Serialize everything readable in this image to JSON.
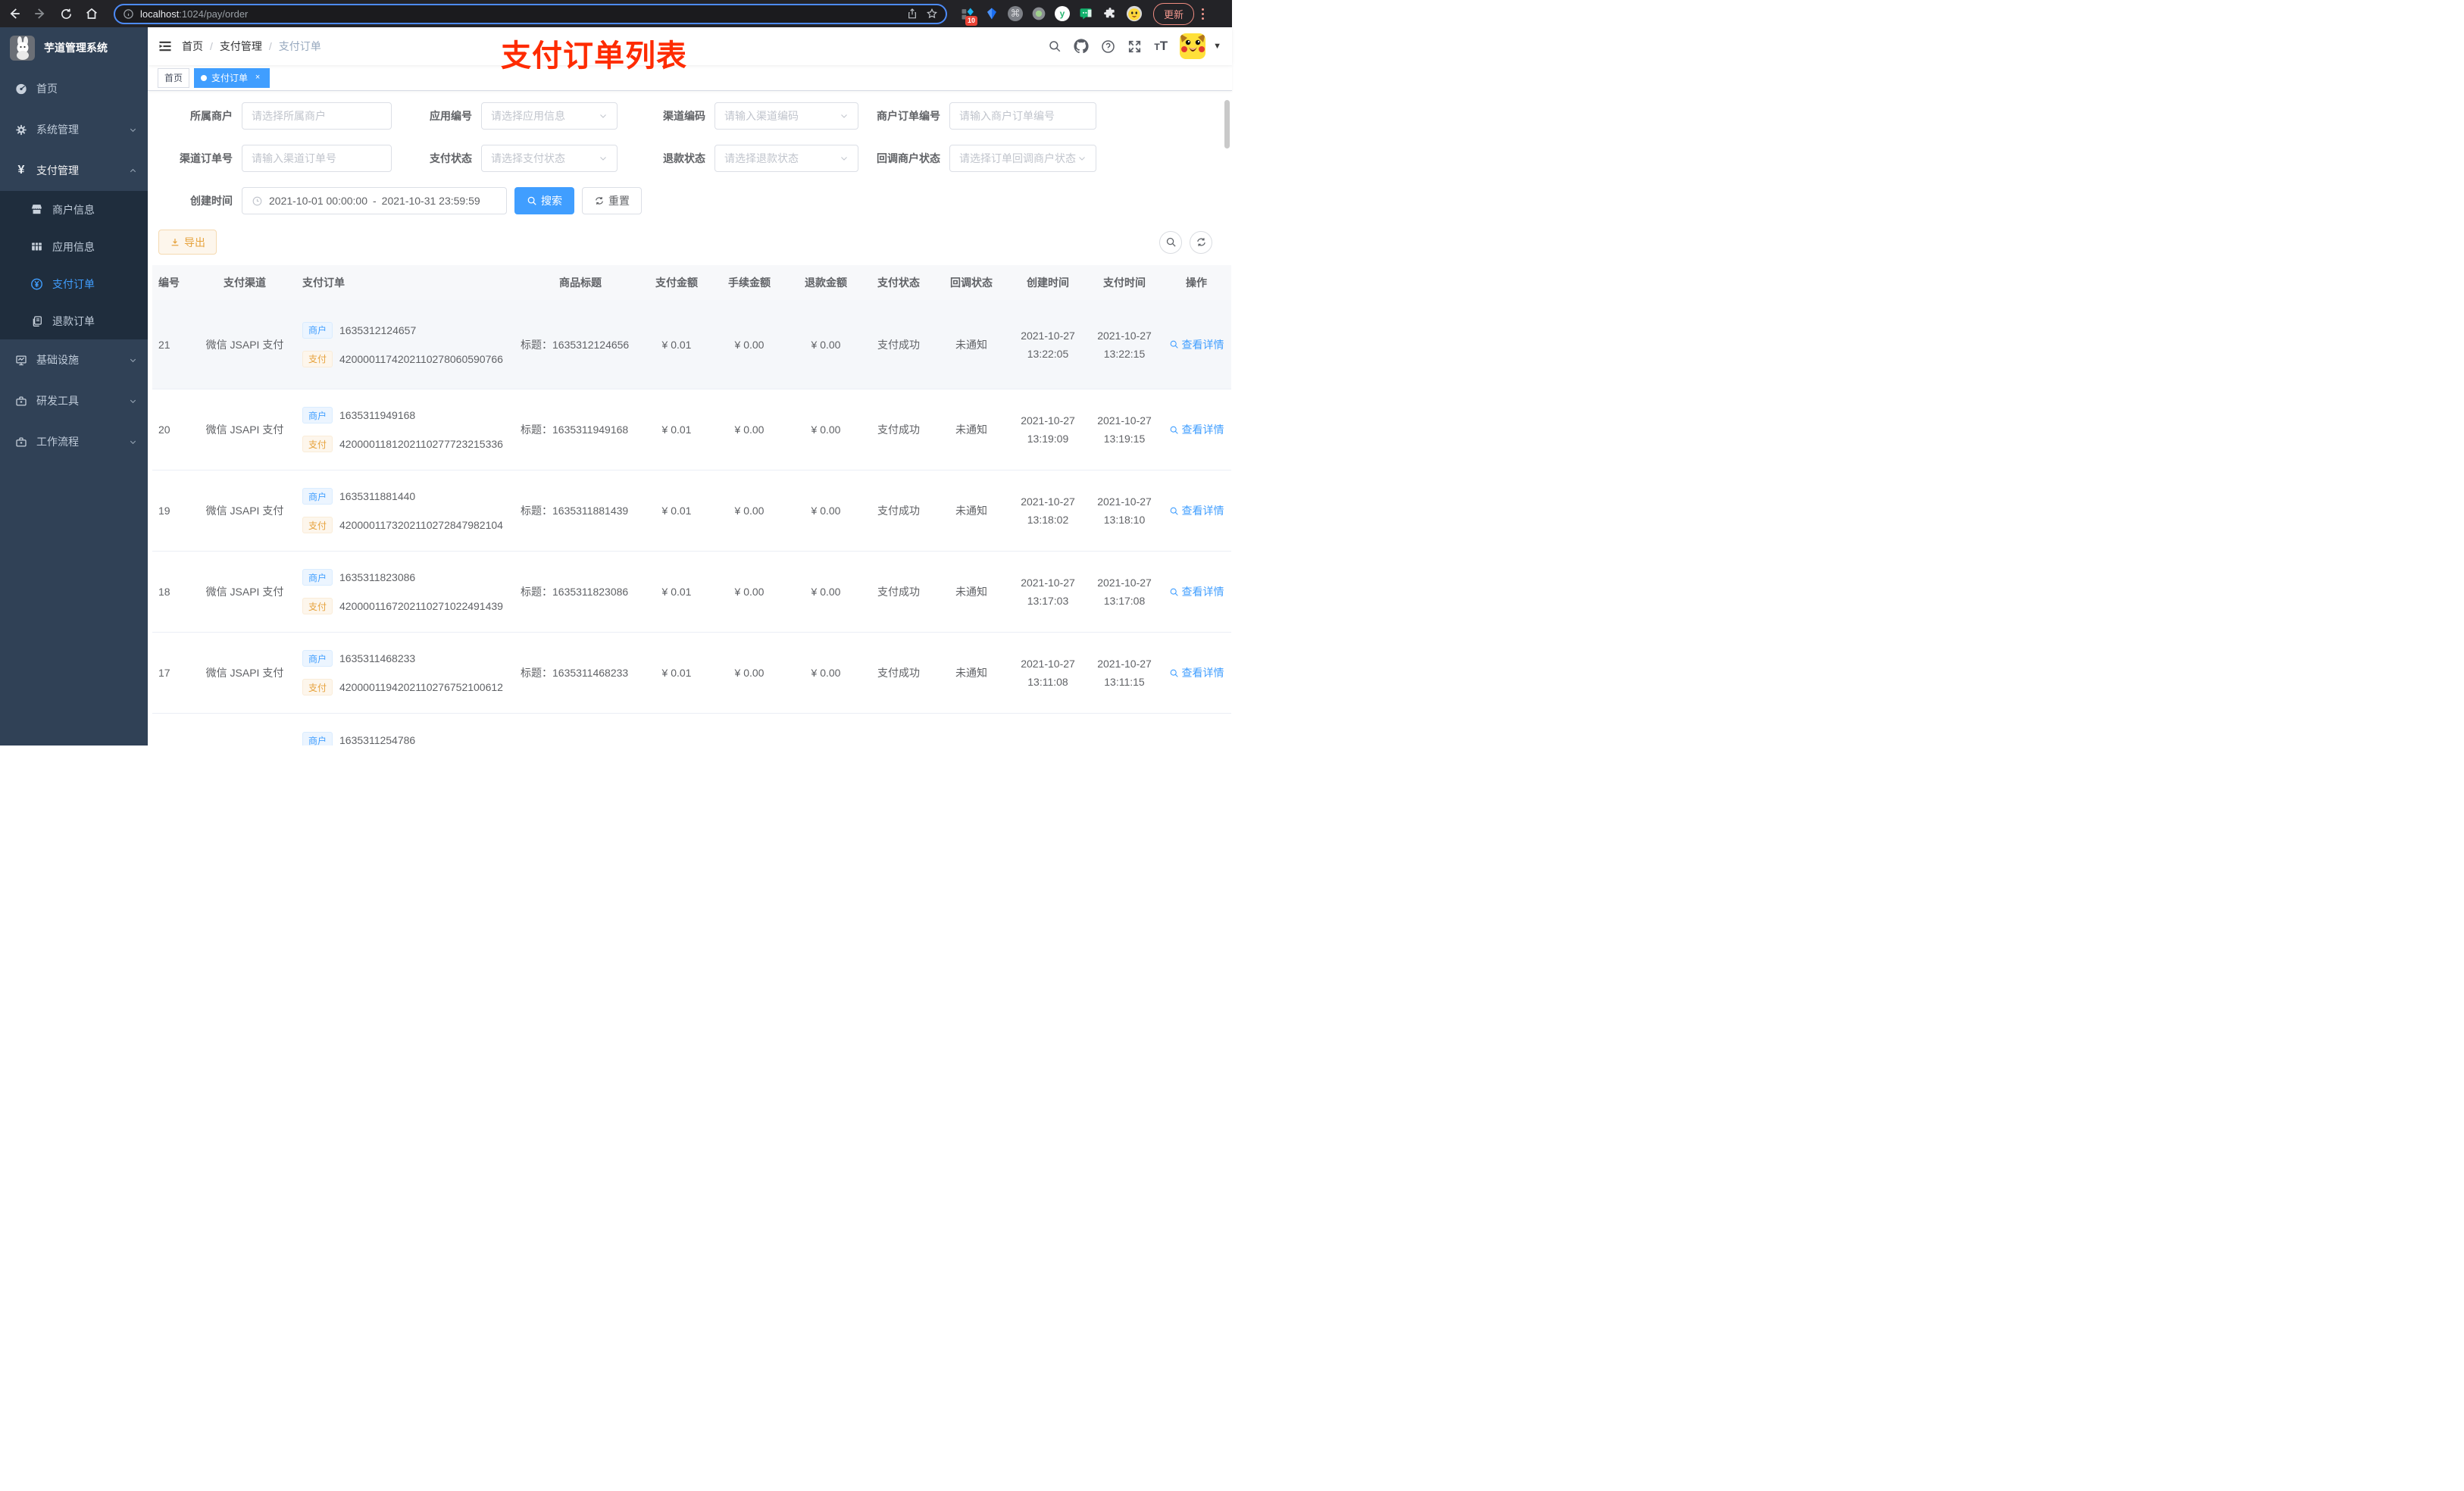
{
  "colors": {
    "accent": "#409eff",
    "warning": "#e6a23c",
    "overlay_red": "#fe2b00",
    "sidebar_bg": "#304156",
    "submenu_bg": "#1f2d3d",
    "active_tag_bg": "#409eff"
  },
  "browser": {
    "url_host": "localhost",
    "url_rest": ":1024/pay/order",
    "extension_badge": "10",
    "update_label": "更新"
  },
  "sidebar": {
    "title": "芋道管理系统",
    "home": "首页",
    "system": "系统管理",
    "pay": "支付管理",
    "merchant_info": "商户信息",
    "app_info": "应用信息",
    "pay_order": "支付订单",
    "refund_order": "退款订单",
    "infra": "基础设施",
    "dev_tools": "研发工具",
    "workflow": "工作流程"
  },
  "navbar": {
    "breadcrumb": [
      "首页",
      "支付管理",
      "支付订单"
    ],
    "overlay_title": "支付订单列表"
  },
  "tags": {
    "home": "首页",
    "active": "支付订单",
    "close": "×"
  },
  "filters": {
    "merchant": {
      "label": "所属商户",
      "placeholder": "请选择所属商户"
    },
    "app": {
      "label": "应用编号",
      "placeholder": "请选择应用信息"
    },
    "channel_code": {
      "label": "渠道编码",
      "placeholder": "请输入渠道编码"
    },
    "merchant_order_no": {
      "label": "商户订单编号",
      "placeholder": "请输入商户订单编号"
    },
    "channel_order_no": {
      "label": "渠道订单号",
      "placeholder": "请输入渠道订单号"
    },
    "pay_status": {
      "label": "支付状态",
      "placeholder": "请选择支付状态"
    },
    "refund_status": {
      "label": "退款状态",
      "placeholder": "请选择退款状态"
    },
    "notify_status": {
      "label": "回调商户状态",
      "placeholder": "请选择订单回调商户状态"
    },
    "create_time": {
      "label": "创建时间",
      "start": "2021-10-01 00:00:00",
      "separator": "-",
      "end": "2021-10-31 23:59:59"
    },
    "search_label": "搜索",
    "reset_label": "重置"
  },
  "toolbar": {
    "export_label": "导出"
  },
  "table": {
    "columns": [
      "编号",
      "支付渠道",
      "支付订单",
      "商品标题",
      "支付金额",
      "手续金额",
      "退款金额",
      "支付状态",
      "回调状态",
      "创建时间",
      "支付时间",
      "操作"
    ],
    "tag_merchant": "商户",
    "tag_pay": "支付",
    "title_prefix": "标题：",
    "action_label": "查看详情",
    "rows": [
      {
        "id": "21",
        "channel": "微信 JSAPI 支付",
        "merchant_no": "1635312124657",
        "pay_no": "4200001174202110278060590766",
        "title": "1635312124656",
        "amount": "¥ 0.01",
        "fee": "¥ 0.00",
        "refund": "¥ 0.00",
        "status": "支付成功",
        "notify": "未通知",
        "created_date": "2021-10-27",
        "created_time": "13:22:05",
        "paid_date": "2021-10-27",
        "paid_time": "13:22:15"
      },
      {
        "id": "20",
        "channel": "微信 JSAPI 支付",
        "merchant_no": "1635311949168",
        "pay_no": "4200001181202110277723215336",
        "title": "1635311949168",
        "amount": "¥ 0.01",
        "fee": "¥ 0.00",
        "refund": "¥ 0.00",
        "status": "支付成功",
        "notify": "未通知",
        "created_date": "2021-10-27",
        "created_time": "13:19:09",
        "paid_date": "2021-10-27",
        "paid_time": "13:19:15"
      },
      {
        "id": "19",
        "channel": "微信 JSAPI 支付",
        "merchant_no": "1635311881440",
        "pay_no": "4200001173202110272847982104",
        "title": "1635311881439",
        "amount": "¥ 0.01",
        "fee": "¥ 0.00",
        "refund": "¥ 0.00",
        "status": "支付成功",
        "notify": "未通知",
        "created_date": "2021-10-27",
        "created_time": "13:18:02",
        "paid_date": "2021-10-27",
        "paid_time": "13:18:10"
      },
      {
        "id": "18",
        "channel": "微信 JSAPI 支付",
        "merchant_no": "1635311823086",
        "pay_no": "4200001167202110271022491439",
        "title": "1635311823086",
        "amount": "¥ 0.01",
        "fee": "¥ 0.00",
        "refund": "¥ 0.00",
        "status": "支付成功",
        "notify": "未通知",
        "created_date": "2021-10-27",
        "created_time": "13:17:03",
        "paid_date": "2021-10-27",
        "paid_time": "13:17:08"
      },
      {
        "id": "17",
        "channel": "微信 JSAPI 支付",
        "merchant_no": "1635311468233",
        "pay_no": "4200001194202110276752100612",
        "title": "1635311468233",
        "amount": "¥ 0.01",
        "fee": "¥ 0.00",
        "refund": "¥ 0.00",
        "status": "支付成功",
        "notify": "未通知",
        "created_date": "2021-10-27",
        "created_time": "13:11:08",
        "paid_date": "2021-10-27",
        "paid_time": "13:11:15"
      }
    ],
    "partial_row": {
      "merchant_no": "1635311254786"
    }
  }
}
